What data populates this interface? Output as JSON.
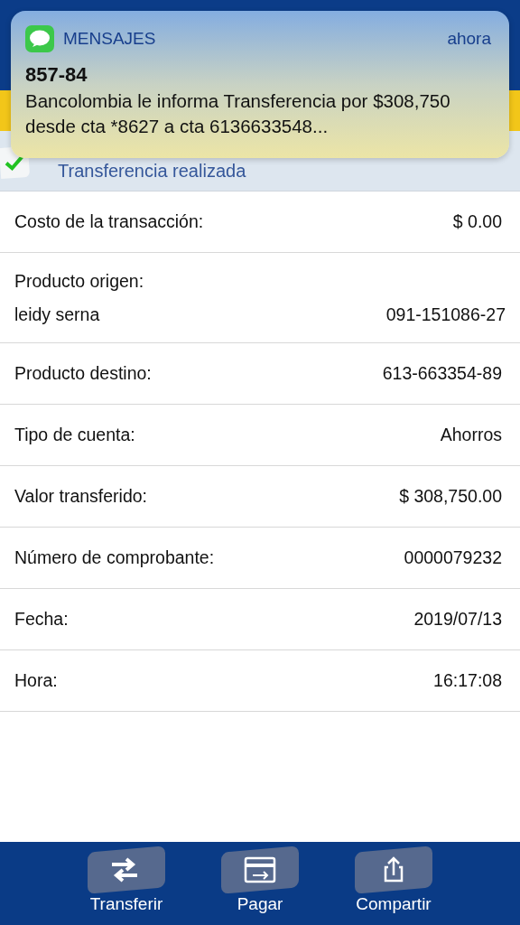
{
  "notification": {
    "app": "MENSAJES",
    "time": "ahora",
    "sender": "857-84",
    "message": "Bancolombia le informa Transferencia por $308,750 desde cta *8627 a cta 6136633548..."
  },
  "status": {
    "text": "Transferencia realizada",
    "success": true
  },
  "details": [
    {
      "label": "Costo de la transacción:",
      "value": "$ 0.00"
    },
    {
      "label": "Producto origen:",
      "sublabel": "leidy serna",
      "value": "091-151086-27"
    },
    {
      "label": "Producto destino:",
      "value": "613-663354-89"
    },
    {
      "label": "Tipo de cuenta:",
      "value": "Ahorros"
    },
    {
      "label": "Valor transferido:",
      "value": "$ 308,750.00"
    },
    {
      "label": "Número de comprobante:",
      "value": "0000079232"
    },
    {
      "label": "Fecha:",
      "value": "2019/07/13"
    },
    {
      "label": "Hora:",
      "value": "16:17:08"
    }
  ],
  "actions": [
    {
      "label": "Transferir",
      "kind": "transfer"
    },
    {
      "label": "Pagar",
      "kind": "pay"
    },
    {
      "label": "Compartir",
      "kind": "share"
    }
  ]
}
